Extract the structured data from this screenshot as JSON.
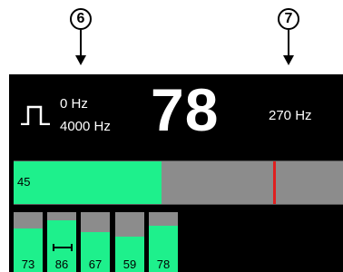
{
  "callouts": [
    {
      "label": "6"
    },
    {
      "label": "7"
    }
  ],
  "display": {
    "waveform_icon": "square-pulse-icon",
    "freq_low": "0 Hz",
    "freq_high": "4000 Hz",
    "main_value": "78",
    "right_freq": "270 Hz"
  },
  "level_bar": {
    "label": "45",
    "value_fraction": 0.45,
    "marker_fraction": 0.79
  },
  "channels": [
    {
      "label": "73",
      "level": 0.73,
      "icon": ""
    },
    {
      "label": "86",
      "level": 0.86,
      "icon": "range-bracket-icon"
    },
    {
      "label": "67",
      "level": 0.67,
      "icon": ""
    },
    {
      "label": "59",
      "level": 0.59,
      "icon": ""
    },
    {
      "label": "78",
      "level": 0.78,
      "icon": ""
    }
  ],
  "colors": {
    "accent": "#1ef08c",
    "track": "#8c8c8c",
    "marker": "#e02020",
    "panel_bg": "#000000"
  }
}
